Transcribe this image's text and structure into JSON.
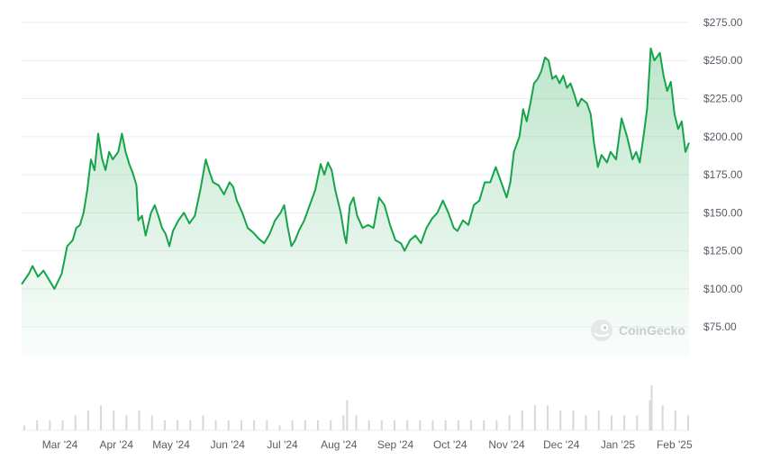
{
  "watermark": {
    "label": "CoinGecko",
    "icon": "coingecko-logo-icon"
  },
  "colors": {
    "line": "#16a34a",
    "fill": "#16a34a",
    "grid": "#edeef0",
    "volume": "#d6d8dc"
  },
  "chart_data": {
    "type": "area",
    "title": "",
    "xlabel": "",
    "ylabel": "",
    "ylim": [
      55,
      285
    ],
    "grid": true,
    "y_ticks": [
      {
        "value": 75,
        "label": "$75.00"
      },
      {
        "value": 100,
        "label": "$100.00"
      },
      {
        "value": 125,
        "label": "$125.00"
      },
      {
        "value": 150,
        "label": "$150.00"
      },
      {
        "value": 175,
        "label": "$175.00"
      },
      {
        "value": 200,
        "label": "$200.00"
      },
      {
        "value": 225,
        "label": "$225.00"
      },
      {
        "value": 250,
        "label": "$250.00"
      },
      {
        "value": 275,
        "label": "$275.00"
      }
    ],
    "x_ticks": [
      {
        "value": "2024-03-01",
        "label": "Mar '24"
      },
      {
        "value": "2024-04-01",
        "label": "Apr '24"
      },
      {
        "value": "2024-05-01",
        "label": "May '24"
      },
      {
        "value": "2024-06-01",
        "label": "Jun '24"
      },
      {
        "value": "2024-07-01",
        "label": "Jul '24"
      },
      {
        "value": "2024-08-01",
        "label": "Aug '24"
      },
      {
        "value": "2024-09-01",
        "label": "Sep '24"
      },
      {
        "value": "2024-10-01",
        "label": "Oct '24"
      },
      {
        "value": "2024-11-01",
        "label": "Nov '24"
      },
      {
        "value": "2024-12-01",
        "label": "Dec '24"
      },
      {
        "value": "2025-01-01",
        "label": "Jan '25"
      },
      {
        "value": "2025-02-01",
        "label": "Feb '25"
      }
    ],
    "x_range": [
      "2024-02-09",
      "2025-02-09"
    ],
    "series": [
      {
        "values": [
          [
            "2024-02-09",
            103
          ],
          [
            "2024-02-13",
            110
          ],
          [
            "2024-02-15",
            115
          ],
          [
            "2024-02-18",
            108
          ],
          [
            "2024-02-21",
            112
          ],
          [
            "2024-02-25",
            104
          ],
          [
            "2024-02-27",
            100
          ],
          [
            "2024-03-02",
            110
          ],
          [
            "2024-03-05",
            128
          ],
          [
            "2024-03-08",
            132
          ],
          [
            "2024-03-10",
            140
          ],
          [
            "2024-03-12",
            142
          ],
          [
            "2024-03-14",
            150
          ],
          [
            "2024-03-16",
            165
          ],
          [
            "2024-03-18",
            185
          ],
          [
            "2024-03-20",
            178
          ],
          [
            "2024-03-22",
            202
          ],
          [
            "2024-03-24",
            186
          ],
          [
            "2024-03-26",
            178
          ],
          [
            "2024-03-28",
            190
          ],
          [
            "2024-03-30",
            185
          ],
          [
            "2024-04-02",
            190
          ],
          [
            "2024-04-04",
            202
          ],
          [
            "2024-04-06",
            190
          ],
          [
            "2024-04-08",
            182
          ],
          [
            "2024-04-10",
            176
          ],
          [
            "2024-04-12",
            168
          ],
          [
            "2024-04-13",
            145
          ],
          [
            "2024-04-15",
            148
          ],
          [
            "2024-04-17",
            135
          ],
          [
            "2024-04-20",
            150
          ],
          [
            "2024-04-22",
            155
          ],
          [
            "2024-04-24",
            148
          ],
          [
            "2024-04-26",
            140
          ],
          [
            "2024-04-28",
            136
          ],
          [
            "2024-04-30",
            128
          ],
          [
            "2024-05-02",
            138
          ],
          [
            "2024-05-05",
            145
          ],
          [
            "2024-05-08",
            150
          ],
          [
            "2024-05-11",
            143
          ],
          [
            "2024-05-14",
            148
          ],
          [
            "2024-05-17",
            165
          ],
          [
            "2024-05-20",
            185
          ],
          [
            "2024-05-22",
            177
          ],
          [
            "2024-05-24",
            170
          ],
          [
            "2024-05-27",
            168
          ],
          [
            "2024-05-30",
            162
          ],
          [
            "2024-06-02",
            170
          ],
          [
            "2024-06-04",
            167
          ],
          [
            "2024-06-06",
            158
          ],
          [
            "2024-06-09",
            150
          ],
          [
            "2024-06-12",
            140
          ],
          [
            "2024-06-15",
            137
          ],
          [
            "2024-06-18",
            133
          ],
          [
            "2024-06-21",
            130
          ],
          [
            "2024-06-24",
            136
          ],
          [
            "2024-06-27",
            145
          ],
          [
            "2024-06-30",
            150
          ],
          [
            "2024-07-02",
            155
          ],
          [
            "2024-07-04",
            140
          ],
          [
            "2024-07-06",
            128
          ],
          [
            "2024-07-08",
            132
          ],
          [
            "2024-07-10",
            138
          ],
          [
            "2024-07-13",
            145
          ],
          [
            "2024-07-16",
            155
          ],
          [
            "2024-07-19",
            165
          ],
          [
            "2024-07-22",
            182
          ],
          [
            "2024-07-24",
            175
          ],
          [
            "2024-07-26",
            183
          ],
          [
            "2024-07-28",
            178
          ],
          [
            "2024-07-30",
            165
          ],
          [
            "2024-08-02",
            150
          ],
          [
            "2024-08-04",
            135
          ],
          [
            "2024-08-05",
            130
          ],
          [
            "2024-08-07",
            155
          ],
          [
            "2024-08-09",
            160
          ],
          [
            "2024-08-11",
            148
          ],
          [
            "2024-08-14",
            140
          ],
          [
            "2024-08-17",
            142
          ],
          [
            "2024-08-20",
            140
          ],
          [
            "2024-08-23",
            160
          ],
          [
            "2024-08-26",
            155
          ],
          [
            "2024-08-29",
            142
          ],
          [
            "2024-09-01",
            132
          ],
          [
            "2024-09-04",
            130
          ],
          [
            "2024-09-06",
            125
          ],
          [
            "2024-09-09",
            132
          ],
          [
            "2024-09-12",
            135
          ],
          [
            "2024-09-15",
            130
          ],
          [
            "2024-09-18",
            140
          ],
          [
            "2024-09-21",
            146
          ],
          [
            "2024-09-24",
            150
          ],
          [
            "2024-09-27",
            158
          ],
          [
            "2024-09-30",
            150
          ],
          [
            "2024-10-03",
            140
          ],
          [
            "2024-10-05",
            138
          ],
          [
            "2024-10-08",
            145
          ],
          [
            "2024-10-11",
            142
          ],
          [
            "2024-10-14",
            155
          ],
          [
            "2024-10-17",
            158
          ],
          [
            "2024-10-20",
            170
          ],
          [
            "2024-10-23",
            170
          ],
          [
            "2024-10-26",
            180
          ],
          [
            "2024-10-29",
            170
          ],
          [
            "2024-11-01",
            160
          ],
          [
            "2024-11-03",
            170
          ],
          [
            "2024-11-05",
            190
          ],
          [
            "2024-11-08",
            200
          ],
          [
            "2024-11-10",
            218
          ],
          [
            "2024-11-12",
            210
          ],
          [
            "2024-11-14",
            222
          ],
          [
            "2024-11-16",
            235
          ],
          [
            "2024-11-18",
            238
          ],
          [
            "2024-11-20",
            243
          ],
          [
            "2024-11-22",
            252
          ],
          [
            "2024-11-24",
            250
          ],
          [
            "2024-11-26",
            238
          ],
          [
            "2024-11-28",
            240
          ],
          [
            "2024-11-30",
            235
          ],
          [
            "2024-12-02",
            240
          ],
          [
            "2024-12-04",
            232
          ],
          [
            "2024-12-06",
            235
          ],
          [
            "2024-12-08",
            228
          ],
          [
            "2024-12-10",
            220
          ],
          [
            "2024-12-12",
            225
          ],
          [
            "2024-12-15",
            222
          ],
          [
            "2024-12-17",
            215
          ],
          [
            "2024-12-19",
            195
          ],
          [
            "2024-12-21",
            180
          ],
          [
            "2024-12-23",
            188
          ],
          [
            "2024-12-26",
            183
          ],
          [
            "2024-12-28",
            190
          ],
          [
            "2024-12-31",
            185
          ],
          [
            "2025-01-03",
            212
          ],
          [
            "2025-01-06",
            200
          ],
          [
            "2025-01-09",
            185
          ],
          [
            "2025-01-11",
            190
          ],
          [
            "2025-01-13",
            183
          ],
          [
            "2025-01-15",
            200
          ],
          [
            "2025-01-17",
            218
          ],
          [
            "2025-01-19",
            258
          ],
          [
            "2025-01-21",
            250
          ],
          [
            "2025-01-24",
            255
          ],
          [
            "2025-01-26",
            240
          ],
          [
            "2025-01-28",
            230
          ],
          [
            "2025-01-30",
            236
          ],
          [
            "2025-02-01",
            215
          ],
          [
            "2025-02-03",
            205
          ],
          [
            "2025-02-05",
            210
          ],
          [
            "2025-02-07",
            190
          ],
          [
            "2025-02-09",
            196
          ]
        ]
      }
    ],
    "volume": {
      "values": [
        [
          "2024-02-10",
          1
        ],
        [
          "2024-02-17",
          2
        ],
        [
          "2024-02-24",
          2
        ],
        [
          "2024-03-02",
          2
        ],
        [
          "2024-03-09",
          3
        ],
        [
          "2024-03-16",
          4
        ],
        [
          "2024-03-23",
          5
        ],
        [
          "2024-03-30",
          4
        ],
        [
          "2024-04-06",
          3
        ],
        [
          "2024-04-13",
          4
        ],
        [
          "2024-04-20",
          3
        ],
        [
          "2024-04-27",
          2
        ],
        [
          "2024-05-04",
          2
        ],
        [
          "2024-05-11",
          2
        ],
        [
          "2024-05-18",
          3
        ],
        [
          "2024-05-25",
          2
        ],
        [
          "2024-06-01",
          2
        ],
        [
          "2024-06-08",
          2
        ],
        [
          "2024-06-15",
          2
        ],
        [
          "2024-06-22",
          2
        ],
        [
          "2024-06-29",
          1
        ],
        [
          "2024-07-06",
          2
        ],
        [
          "2024-07-13",
          2
        ],
        [
          "2024-07-20",
          2
        ],
        [
          "2024-07-27",
          2
        ],
        [
          "2024-08-03",
          3
        ],
        [
          "2024-08-05",
          6
        ],
        [
          "2024-08-10",
          3
        ],
        [
          "2024-08-17",
          2
        ],
        [
          "2024-08-24",
          2
        ],
        [
          "2024-08-31",
          2
        ],
        [
          "2024-09-07",
          2
        ],
        [
          "2024-09-14",
          2
        ],
        [
          "2024-09-21",
          2
        ],
        [
          "2024-09-28",
          2
        ],
        [
          "2024-10-05",
          2
        ],
        [
          "2024-10-12",
          2
        ],
        [
          "2024-10-19",
          2
        ],
        [
          "2024-10-26",
          2
        ],
        [
          "2024-11-02",
          3
        ],
        [
          "2024-11-09",
          4
        ],
        [
          "2024-11-16",
          5
        ],
        [
          "2024-11-23",
          5
        ],
        [
          "2024-11-30",
          4
        ],
        [
          "2024-12-07",
          4
        ],
        [
          "2024-12-14",
          3
        ],
        [
          "2024-12-21",
          4
        ],
        [
          "2024-12-28",
          3
        ],
        [
          "2025-01-04",
          3
        ],
        [
          "2025-01-11",
          3
        ],
        [
          "2025-01-18",
          6
        ],
        [
          "2025-01-19",
          9
        ],
        [
          "2025-01-25",
          5
        ],
        [
          "2025-02-01",
          4
        ],
        [
          "2025-02-08",
          3
        ]
      ]
    }
  }
}
